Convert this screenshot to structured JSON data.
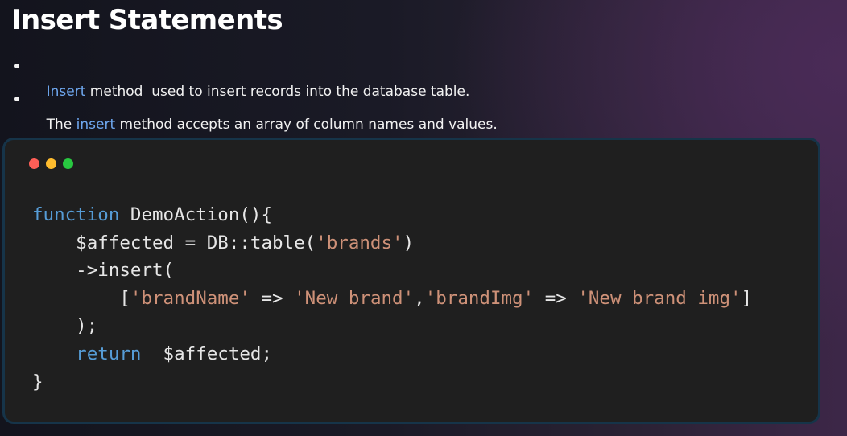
{
  "title": "Insert Statements",
  "bullets": [
    {
      "highlight": "Insert",
      "text": " method  used to insert records into the database table."
    },
    {
      "prefix": "The ",
      "highlight": "insert",
      "text": " method accepts an array of column names and values."
    }
  ],
  "colors": {
    "highlight": "#6fa8f0",
    "keyword": "#569cd6",
    "string": "#ce9178",
    "code_background": "#1f1f1f",
    "window_border": "#163449"
  },
  "window_controls": [
    "close-dot",
    "minimize-dot",
    "maximize-dot"
  ],
  "code": {
    "language": "php",
    "lines": [
      [
        {
          "t": "kw",
          "v": "function"
        },
        {
          "t": "plain",
          "v": " DemoAction(){"
        }
      ],
      [
        {
          "t": "plain",
          "v": "    $affected = DB::table("
        },
        {
          "t": "str",
          "v": "'brands'"
        },
        {
          "t": "plain",
          "v": ")"
        }
      ],
      [
        {
          "t": "plain",
          "v": "    ->insert("
        }
      ],
      [
        {
          "t": "plain",
          "v": "        ["
        },
        {
          "t": "str",
          "v": "'brandName'"
        },
        {
          "t": "plain",
          "v": " => "
        },
        {
          "t": "str",
          "v": "'New brand'"
        },
        {
          "t": "plain",
          "v": ","
        },
        {
          "t": "str",
          "v": "'brandImg'"
        },
        {
          "t": "plain",
          "v": " => "
        },
        {
          "t": "str",
          "v": "'New brand img'"
        },
        {
          "t": "plain",
          "v": "]"
        }
      ],
      [
        {
          "t": "plain",
          "v": "    );"
        }
      ],
      [
        {
          "t": "kw",
          "v": "    return"
        },
        {
          "t": "plain",
          "v": "  $affected;"
        }
      ],
      [
        {
          "t": "plain",
          "v": "}"
        }
      ]
    ]
  }
}
